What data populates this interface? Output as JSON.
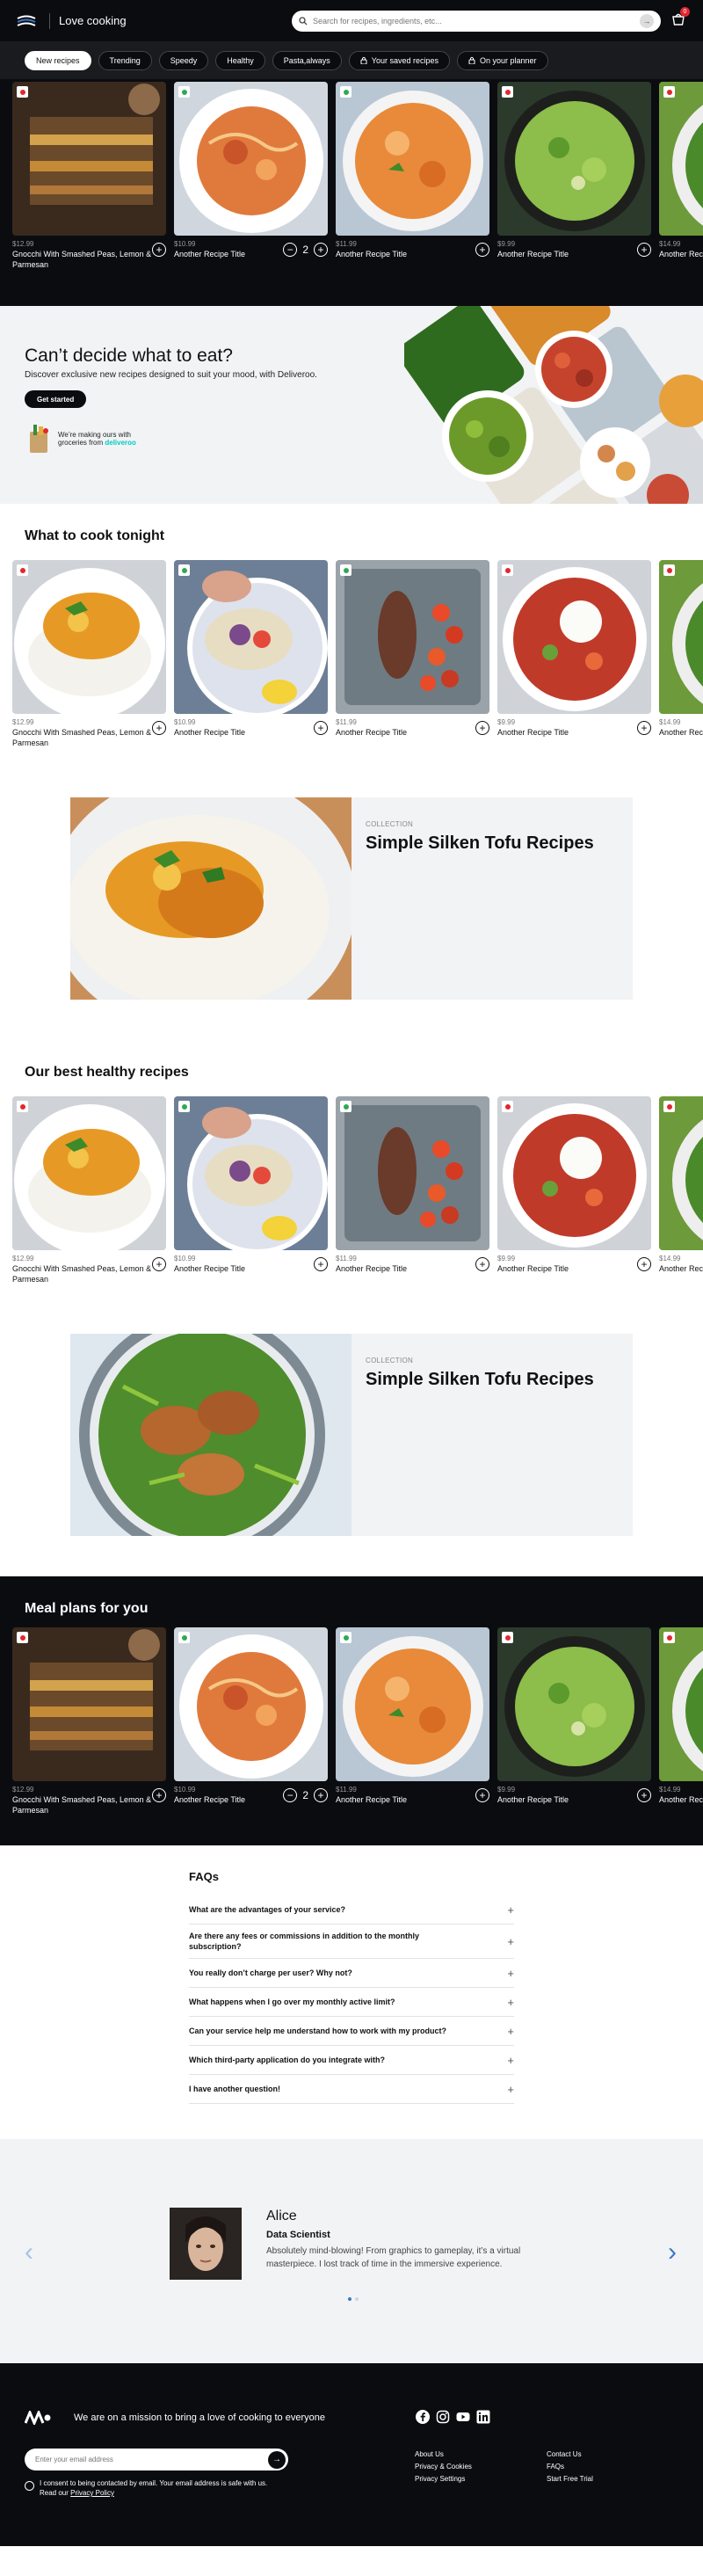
{
  "header": {
    "site_title": "Love cooking",
    "search_placeholder": "Search for recipes, ingredients, etc...",
    "cart_count": "0"
  },
  "filters": [
    {
      "label": "New recipes",
      "active": true,
      "icon": ""
    },
    {
      "label": "Trending",
      "active": false,
      "icon": ""
    },
    {
      "label": "Speedy",
      "active": false,
      "icon": ""
    },
    {
      "label": "Healthy",
      "active": false,
      "icon": ""
    },
    {
      "label": "Pasta,always",
      "active": false,
      "icon": ""
    },
    {
      "label": "Your saved recipes",
      "active": false,
      "icon": "lock-icon"
    },
    {
      "label": "On your planner",
      "active": false,
      "icon": "lock-icon"
    }
  ],
  "carousel_top": [
    {
      "price": "$12.99",
      "name": "Gnocchi With Smashed Peas, Lemon & Parmesan",
      "dot": "#e3262f",
      "control": "add",
      "food": "lasagna"
    },
    {
      "price": "$10.99",
      "name": "Another Recipe Title",
      "dot": "#2eaa52",
      "control": "stepper",
      "qty": "2",
      "food": "spaghetti"
    },
    {
      "price": "$11.99",
      "name": "Another Recipe Title",
      "dot": "#2eaa52",
      "control": "add",
      "food": "curry"
    },
    {
      "price": "$9.99",
      "name": "Another Recipe Title",
      "dot": "#e3262f",
      "control": "add",
      "food": "greens"
    },
    {
      "price": "$14.99",
      "name": "Another Recipe Title",
      "dot": "#e3262f",
      "control": "add",
      "food": "salad"
    }
  ],
  "promo": {
    "title": "Can’t decide what to eat?",
    "subtitle": "Discover exclusive new recipes designed to suit your mood, with Deliveroo.",
    "button": "Get started",
    "groceries_line1": "We’re making ours with",
    "groceries_line2": "groceries from",
    "brand": "deliveroo"
  },
  "section_cook_tonight": {
    "title": "What to cook tonight",
    "items": [
      {
        "price": "$12.99",
        "name": "Gnocchi With Smashed Peas, Lemon & Parmesan",
        "dot": "#e3262f",
        "food": "rice"
      },
      {
        "price": "$10.99",
        "name": "Another Recipe Title",
        "dot": "#2eaa52",
        "food": "wrap"
      },
      {
        "price": "$11.99",
        "name": "Another Recipe Title",
        "dot": "#2eaa52",
        "food": "roast"
      },
      {
        "price": "$9.99",
        "name": "Another Recipe Title",
        "dot": "#e3262f",
        "food": "burrata"
      },
      {
        "price": "$14.99",
        "name": "Another Recipe Title",
        "dot": "#e3262f",
        "food": "salad"
      }
    ]
  },
  "collection1": {
    "kicker": "COLLECTION",
    "title": "Simple Silken Tofu Recipes"
  },
  "section_healthy": {
    "title": "Our best healthy recipes",
    "items": [
      {
        "price": "$12.99",
        "name": "Gnocchi With Smashed Peas, Lemon & Parmesan",
        "dot": "#e3262f",
        "food": "rice"
      },
      {
        "price": "$10.99",
        "name": "Another Recipe Title",
        "dot": "#2eaa52",
        "food": "wrap"
      },
      {
        "price": "$11.99",
        "name": "Another Recipe Title",
        "dot": "#2eaa52",
        "food": "roast"
      },
      {
        "price": "$9.99",
        "name": "Another Recipe Title",
        "dot": "#e3262f",
        "food": "burrata"
      },
      {
        "price": "$14.99",
        "name": "Another Recipe Title",
        "dot": "#e3262f",
        "food": "salad"
      }
    ]
  },
  "collection2": {
    "kicker": "COLLECTION",
    "title": "Simple Silken Tofu Recipes"
  },
  "section_meal_plans": {
    "title": "Meal plans for you",
    "items": [
      {
        "price": "$12.99",
        "name": "Gnocchi With Smashed Peas, Lemon & Parmesan",
        "dot": "#e3262f",
        "control": "add",
        "food": "lasagna"
      },
      {
        "price": "$10.99",
        "name": "Another Recipe Title",
        "dot": "#2eaa52",
        "control": "stepper",
        "qty": "2",
        "food": "spaghetti"
      },
      {
        "price": "$11.99",
        "name": "Another Recipe Title",
        "dot": "#2eaa52",
        "control": "add",
        "food": "curry"
      },
      {
        "price": "$9.99",
        "name": "Another Recipe Title",
        "dot": "#e3262f",
        "control": "add",
        "food": "greens"
      },
      {
        "price": "$14.99",
        "name": "Another Recipe Title",
        "dot": "#e3262f",
        "control": "add",
        "food": "salad"
      }
    ]
  },
  "faq": {
    "title": "FAQs",
    "items": [
      "What are the advantages of your service?",
      "Are there any fees or commissions in addition to the monthly subscription?",
      "You really don’t charge per user? Why not?",
      "What happens when I go over my monthly active limit?",
      "Can your service help me understand how to work with my product?",
      "Which third-party application do you integrate with?",
      "I have another question!"
    ]
  },
  "testimonial": {
    "name": "Alice",
    "role": "Data Scientist",
    "quote": "Absolutely mind-blowing! From graphics to gameplay, it’s a virtual masterpiece. I lost track of time in the immersive experience."
  },
  "footer": {
    "mission": "We are on a mission to bring a love of cooking to everyone",
    "email_placeholder": "Enter your email address",
    "consent": "I consent to being contacted by email. Your email address is safe with us.",
    "consent_read": "Read our",
    "privacy_link": "Privacy Policy",
    "links_col1": [
      "About Us",
      "Privacy & Cookies",
      "Privacy Settings"
    ],
    "links_col2": [
      "Contact Us",
      "FAQs",
      "Start Free Trial"
    ],
    "social_icons": [
      "facebook-icon",
      "instagram-icon",
      "youtube-icon",
      "linkedin-icon"
    ]
  },
  "colors": {
    "dark_bg": "#0b0c10",
    "accent_blue": "#3b77c7",
    "badge_red": "#e3262f",
    "badge_green": "#2eaa52"
  }
}
